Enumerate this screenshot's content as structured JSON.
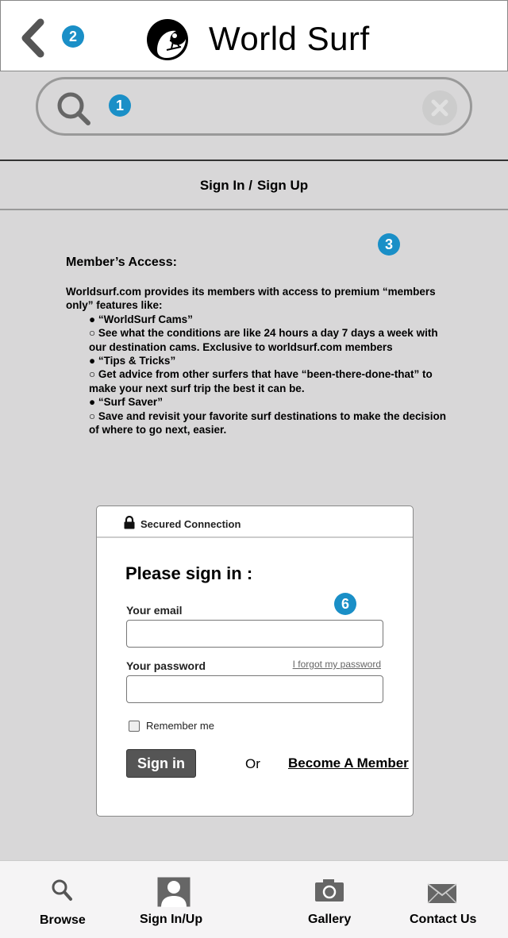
{
  "header": {
    "title": "World Surf",
    "back_icon": "chevron-left-icon",
    "logo_icon": "surfer-wave-logo",
    "annotation_back": "2"
  },
  "search": {
    "placeholder": "",
    "value": "",
    "annotation": "1"
  },
  "auth_tabs": {
    "sign_in": "Sign In /",
    "sign_up": "Sign Up"
  },
  "members": {
    "annotation": "3",
    "title": "Member’s Access:",
    "intro": "Worldsurf.com provides its members with access to premium “members only” features like:",
    "features": [
      {
        "bullet": "● “WorldSurf Cams”",
        "desc": "○ See what the conditions are like 24 hours a day 7 days a week with our destination cams. Exclusive to worldsurf.com members"
      },
      {
        "bullet": "● “Tips & Tricks”",
        "desc": "○ Get advice from other surfers that have “been-there-done-that” to make your next surf trip the best it can be."
      },
      {
        "bullet": "● “Surf Saver”",
        "desc": "○ Save and revisit your favorite surf destinations to make the decision of where to go next, easier."
      }
    ]
  },
  "signin_form": {
    "secure_label": "Secured Connection",
    "title": "Please sign in :",
    "annotation": "6",
    "email_label": "Your email",
    "email_value": "",
    "password_label": "Your password",
    "password_value": "",
    "forgot_link": "I forgot my password",
    "remember_label": "Remember me",
    "remember_checked": false,
    "signin_button": "Sign in",
    "or_text": "Or",
    "member_link": "Become A Member"
  },
  "bottom_nav": {
    "items": [
      {
        "label": "Browse",
        "icon": "search-icon"
      },
      {
        "label": "Sign In/Up",
        "icon": "user-icon"
      },
      {
        "label": "Gallery",
        "icon": "camera-icon"
      },
      {
        "label": "Contact Us",
        "icon": "envelope-icon"
      }
    ]
  },
  "colors": {
    "accent": "#1a8fc7",
    "background": "#d8d7d8",
    "button": "#555555"
  }
}
